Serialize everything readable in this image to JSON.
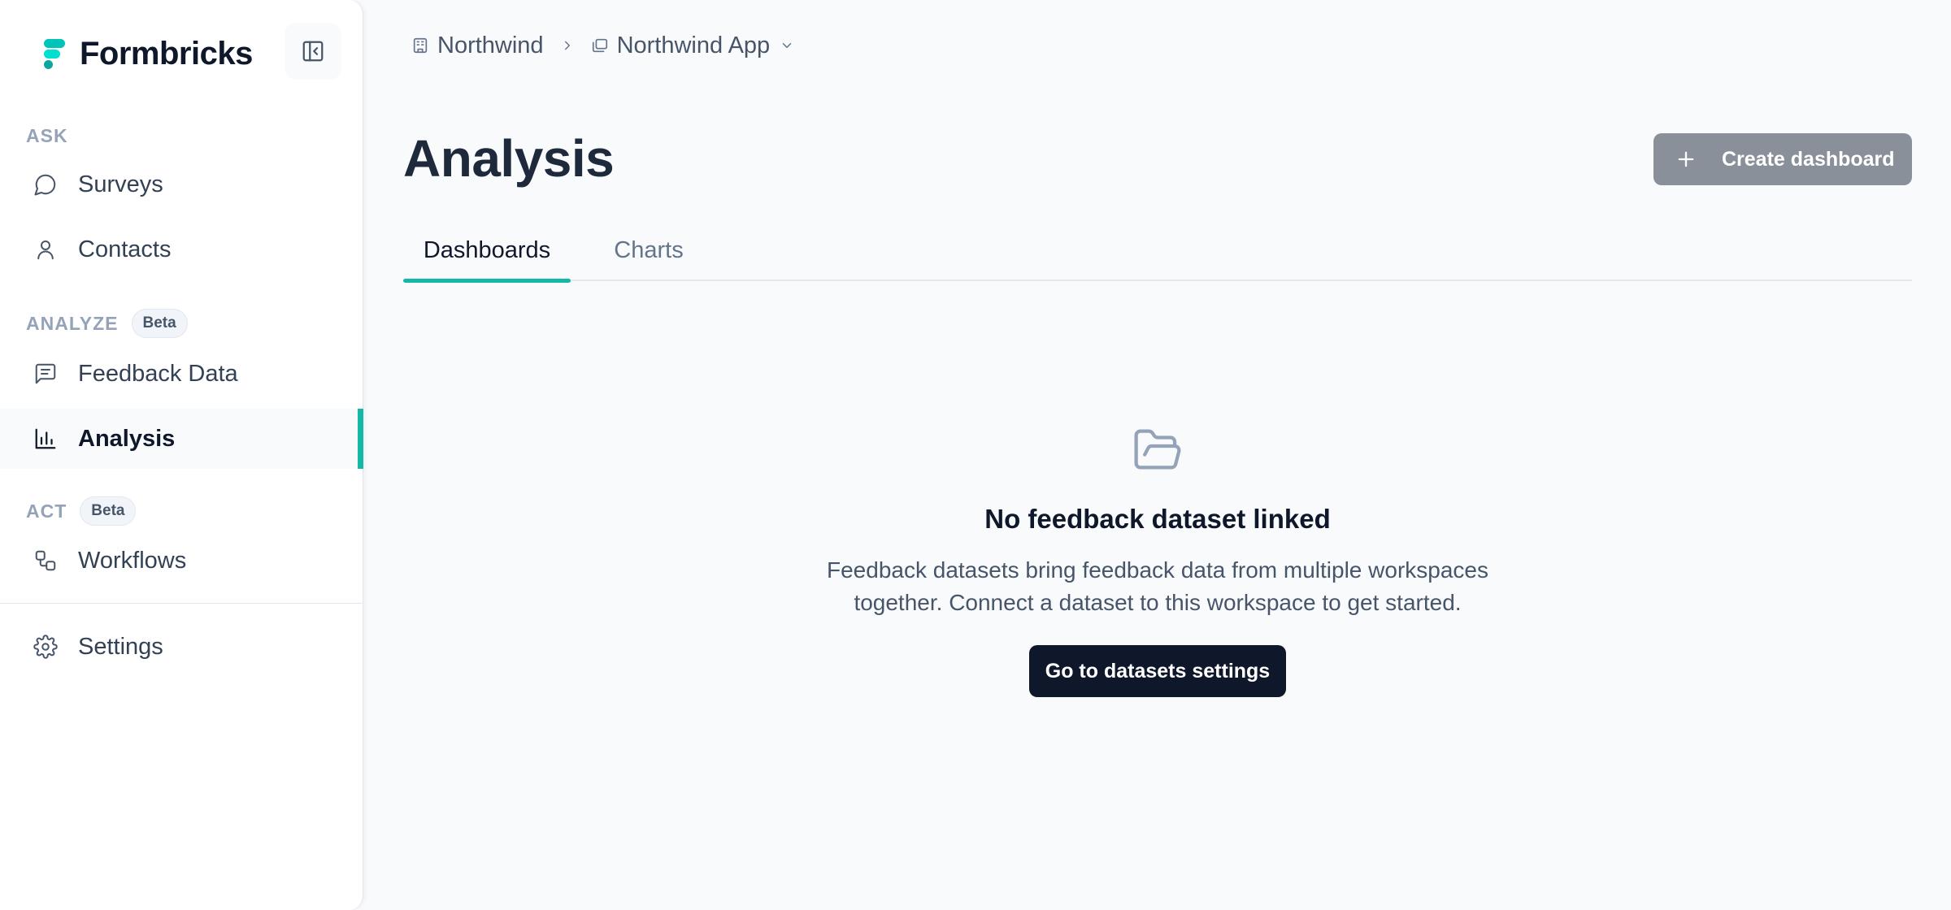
{
  "brand": {
    "name": "Formbricks",
    "logo_icon": "formbricks-logo-icon",
    "accent": "#14b8a6"
  },
  "sidebar": {
    "collapse_icon": "panel-collapse-icon",
    "sections": [
      {
        "label": "ASK",
        "badge": ""
      },
      {
        "label": "ANALYZE",
        "badge": "Beta"
      },
      {
        "label": "ACT",
        "badge": "Beta"
      }
    ],
    "items": [
      {
        "label": "Surveys",
        "icon": "message-circle-icon"
      },
      {
        "label": "Contacts",
        "icon": "user-icon"
      },
      {
        "label": "Feedback Data",
        "icon": "message-square-text-icon"
      },
      {
        "label": "Analysis",
        "icon": "bar-chart-icon",
        "active": true
      },
      {
        "label": "Workflows",
        "icon": "workflow-icon"
      },
      {
        "label": "Settings",
        "icon": "gear-icon"
      }
    ]
  },
  "breadcrumb": {
    "organization": "Northwind",
    "organization_icon": "building-icon",
    "project": "Northwind App",
    "project_icon": "folders-icon"
  },
  "header": {
    "title": "Analysis",
    "create_button": "Create dashboard"
  },
  "tabs": [
    {
      "label": "Dashboards",
      "active": true
    },
    {
      "label": "Charts",
      "active": false
    }
  ],
  "empty_state": {
    "icon": "folder-open-icon",
    "title": "No feedback dataset linked",
    "description": "Feedback datasets bring feedback data from multiple workspaces together. Connect a dataset to this workspace to get started.",
    "button": "Go to datasets settings"
  }
}
